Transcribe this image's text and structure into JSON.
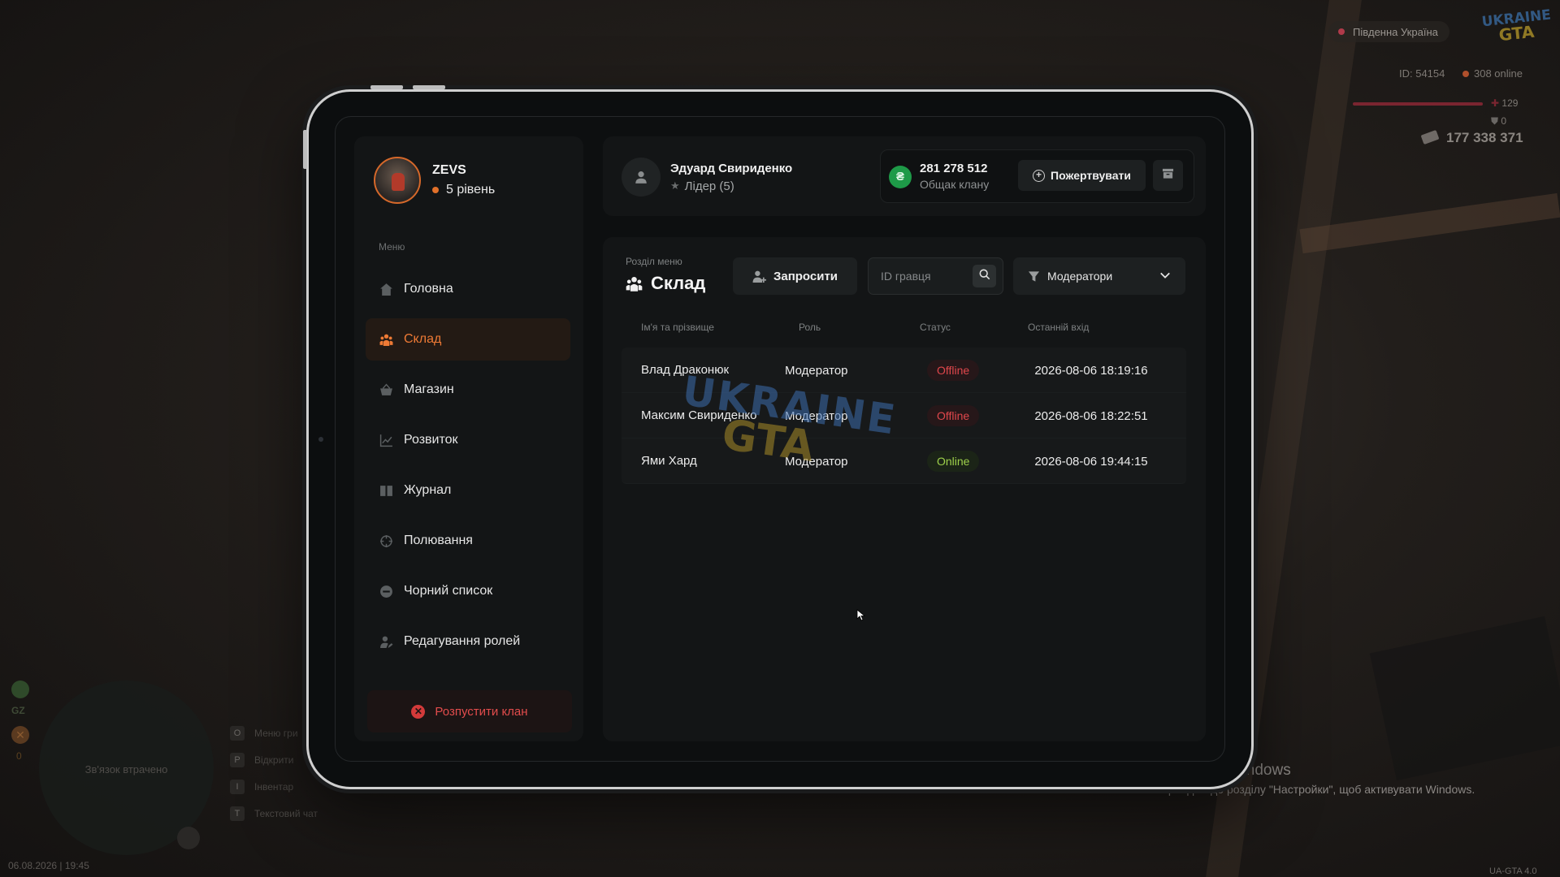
{
  "hud": {
    "server": "Південна Україна",
    "logo_line1": "UKRAINE",
    "logo_line2": "GTA",
    "player_id": "ID: 54154",
    "online": "308 online",
    "health": "129",
    "armor": "0",
    "money": "177 338 371",
    "minimap_text": "Зв'язок втрачено",
    "gz_label": "GZ",
    "wanted_count": "0",
    "keys": [
      {
        "key": "O",
        "label": "Меню гри"
      },
      {
        "key": "P",
        "label": "Відкрити"
      },
      {
        "key": "I",
        "label": "Інвентар"
      },
      {
        "key": "T",
        "label": "Текстовий чат"
      }
    ],
    "datetime": "06.08.2026 | 19:45",
    "version": "UA-GTA 4.0"
  },
  "windows": {
    "title": "Активація Windows",
    "subtitle": "Перейдіть до розділу \"Настройки\", щоб активувати Windows."
  },
  "profile": {
    "name": "ZEVS",
    "level": "5 рівень"
  },
  "sidebar": {
    "menu_heading": "Меню",
    "items": [
      {
        "label": "Головна",
        "icon": "home-icon"
      },
      {
        "label": "Склад",
        "icon": "members-icon"
      },
      {
        "label": "Магазин",
        "icon": "basket-icon"
      },
      {
        "label": "Розвиток",
        "icon": "chart-icon"
      },
      {
        "label": "Журнал",
        "icon": "book-icon"
      },
      {
        "label": "Полювання",
        "icon": "crosshair-icon"
      },
      {
        "label": "Чорний список",
        "icon": "block-icon"
      },
      {
        "label": "Редагування ролей",
        "icon": "user-edit-icon"
      }
    ],
    "active_index": 1,
    "dissolve_label": "Розпустити клан"
  },
  "header": {
    "leader_name": "Эдуард Свириденко",
    "leader_role": "Лідер (5)",
    "bank_amount": "281 278 512",
    "bank_label": "Общак клану",
    "donate_label": "Пожертвувати"
  },
  "main": {
    "section_caption": "Розділ меню",
    "section_title": "Склад",
    "invite_label": "Запросити",
    "search_placeholder": "ID гравця",
    "filter_value": "Модератори",
    "columns": [
      "Ім'я та прізвище",
      "Роль",
      "Статус",
      "Останній вхід"
    ],
    "rows": [
      {
        "name": "Влад Драконюк",
        "role": "Модератор",
        "status": "Offline",
        "last_login": "2026-08-06 18:19:16"
      },
      {
        "name": "Максим Свириденко",
        "role": "Модератор",
        "status": "Offline",
        "last_login": "2026-08-06 18:22:51"
      },
      {
        "name": "Ями Хард",
        "role": "Модератор",
        "status": "Online",
        "last_login": "2026-08-06 19:44:15"
      }
    ],
    "watermark_line1": "UKRAINE",
    "watermark_line2": "GTA"
  },
  "colors": {
    "accent": "#ee7a35",
    "offline": "#e0474c",
    "online": "#9ed14b",
    "bank": "#1e9a48",
    "danger": "#e24c4c"
  }
}
